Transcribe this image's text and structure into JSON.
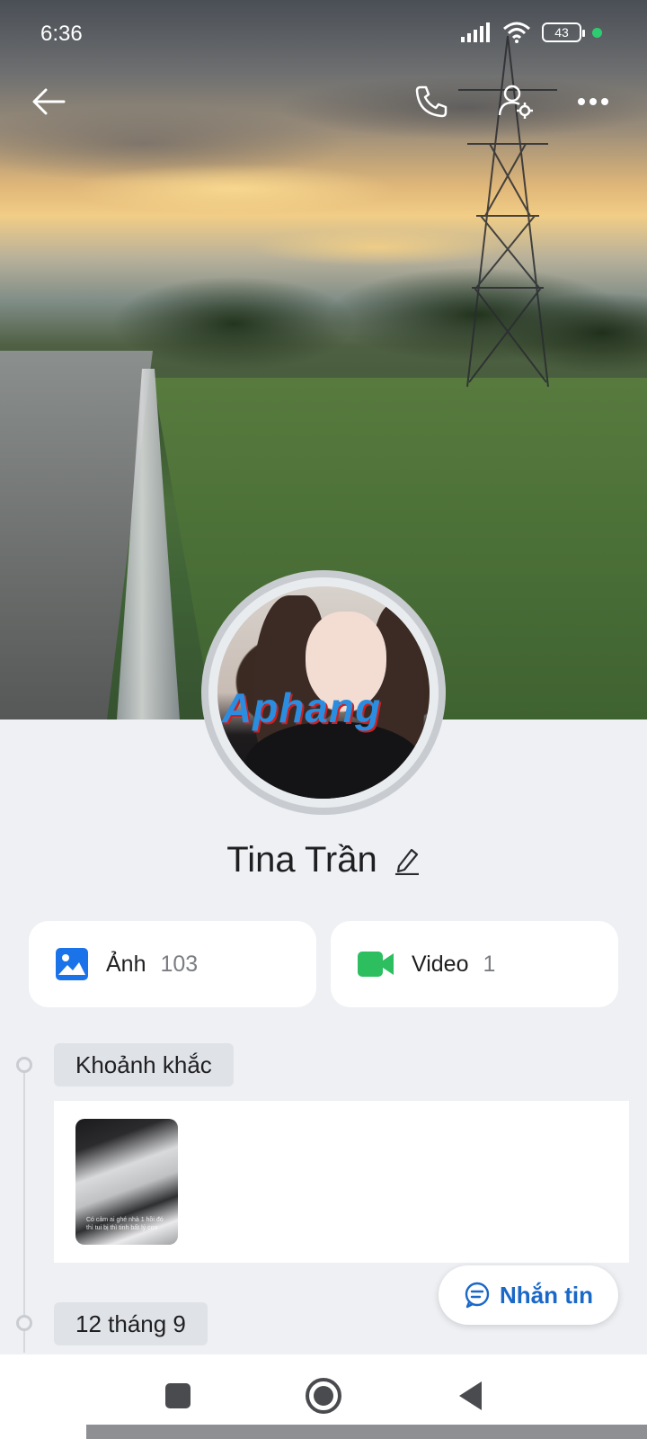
{
  "status_bar": {
    "time": "6:36",
    "battery": "43",
    "icons": [
      "signal-icon",
      "wifi-icon",
      "battery-icon",
      "active-dot"
    ]
  },
  "topbar": {
    "icons": [
      "back-arrow-icon",
      "phone-icon",
      "user-settings-icon",
      "more-icon"
    ]
  },
  "profile": {
    "name": "Tina Trần",
    "avatar_watermark": "Aphang",
    "edit_icon": "pencil-icon"
  },
  "media": {
    "photos": {
      "label": "Ảnh",
      "count": "103",
      "icon": "image-icon",
      "color": "#1a73e8"
    },
    "videos": {
      "label": "Video",
      "count": "1",
      "icon": "video-camera-icon",
      "color": "#2dbe60"
    }
  },
  "timeline": {
    "moments_label": "Khoảnh khắc",
    "moment_caption": "Có cảm ai ghé nhà 1 hồi đó thì tui bị thì tinh bất lý con",
    "date_label": "12 tháng 9"
  },
  "message_button": {
    "label": "Nhắn tin",
    "icon": "chat-bubble-icon"
  },
  "nav": {
    "icons": [
      "recent-apps-icon",
      "home-icon",
      "back-triangle-icon"
    ]
  },
  "colors": {
    "accent": "#1a68c7",
    "background": "#eef0f4",
    "card": "#ffffff"
  }
}
